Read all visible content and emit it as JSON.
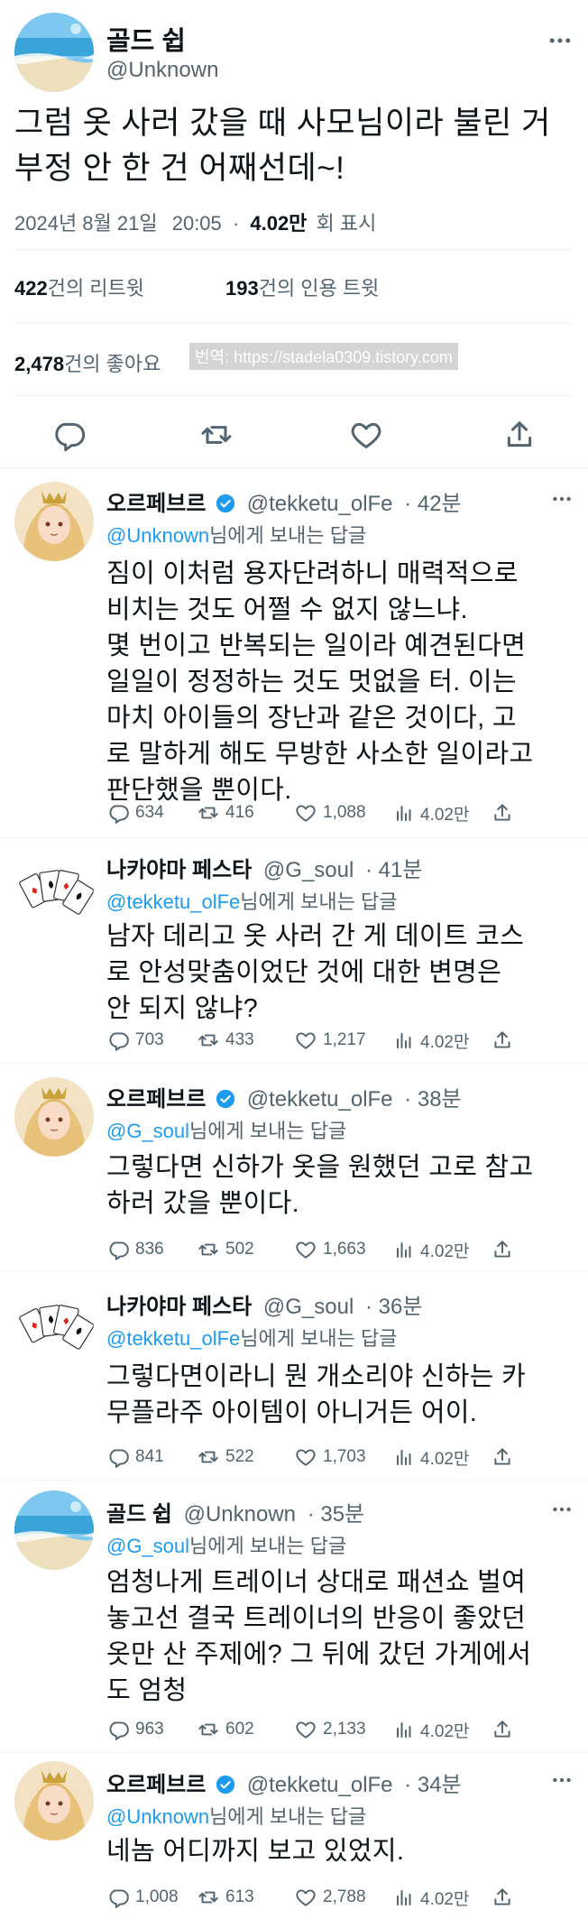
{
  "main_tweet": {
    "name": "골드 쉽",
    "handle": "@Unknown",
    "text": "그럼 옷 사러 갔을 때 사모님이라 불린 거\n부정 안 한 건 어째선데~!",
    "date": "2024년 8월 21일",
    "time": "20:05",
    "dot": "·",
    "views": "4.02만",
    "views_label": "회 표시",
    "retweets": "422",
    "retweets_label": "건의 리트윗",
    "quotes": "193",
    "quotes_label": "건의 인용 트윗",
    "likes": "2,478",
    "likes_label": "건의 좋아요",
    "watermark": "번역: https://stadela0309.tistory.com"
  },
  "replies": [
    {
      "name": "오르페브르",
      "handle": "@tekketu_olFe",
      "time": "· 42분",
      "to_mention": "@Unknown",
      "to_suffix": "님에게 보내는 답글",
      "text": "짐이 이처럼 용자단려하니 매력적으로\n비치는 것도 어쩔 수 없지 않느냐.\n몇 번이고 반복되는 일이라 예견된다면\n일일이 정정하는 것도 멋없을 터. 이는\n마치 아이들의 장난과 같은 것이다, 고\n로 말하게 해도 무방한 사소한 일이라고\n판단했을 뿐이다.",
      "replies": "634",
      "retweets": "416",
      "likes": "1,088",
      "views": "4.02만"
    },
    {
      "name": "나카야마 페스타",
      "handle": "@G_soul",
      "time": "· 41분",
      "to_mention": "@tekketu_olFe",
      "to_suffix": "님에게 보내는 답글",
      "text": "남자 데리고 옷 사러 간 게 데이트 코스\n로 안성맞춤이었단 것에 대한 변명은\n안 되지 않냐?",
      "replies": "703",
      "retweets": "433",
      "likes": "1,217",
      "views": "4.02만"
    },
    {
      "name": "오르페브르",
      "handle": "@tekketu_olFe",
      "time": "· 38분",
      "to_mention": "@G_soul",
      "to_suffix": "님에게 보내는 답글",
      "text": "그렇다면 신하가 옷을 원했던 고로 참고\n하러 갔을 뿐이다.",
      "replies": "836",
      "retweets": "502",
      "likes": "1,663",
      "views": "4.02만"
    },
    {
      "name": "나카야마 페스타",
      "handle": "@G_soul",
      "time": "· 36분",
      "to_mention": "@tekketu_olFe",
      "to_suffix": "님에게 보내는 답글",
      "text": "그렇다면이라니 뭔 개소리야 신하는 카\n무플라주 아이템이 아니거든 어이.",
      "replies": "841",
      "retweets": "522",
      "likes": "1,703",
      "views": "4.02만"
    },
    {
      "name": "골드 쉽",
      "handle": "@Unknown",
      "time": "· 35분",
      "to_mention": "@G_soul",
      "to_suffix": "님에게 보내는 답글",
      "text": "엄청나게 트레이너 상대로 패션쇼 벌여\n놓고선 결국 트레이너의 반응이 좋았던\n옷만 산 주제에? 그 뒤에 갔던 가게에서\n도 엄청",
      "replies": "963",
      "retweets": "602",
      "likes": "2,133",
      "views": "4.02만"
    },
    {
      "name": "오르페브르",
      "handle": "@tekketu_olFe",
      "time": "· 34분",
      "to_mention": "@Unknown",
      "to_suffix": "님에게 보내는 답글",
      "text": "네놈 어디까지 보고 있었지.",
      "replies": "1,008",
      "retweets": "613",
      "likes": "2,788",
      "views": "4.02만"
    }
  ],
  "colors": {
    "text": "#0f1419",
    "secondary": "#536471",
    "mention": "#1d9bf0",
    "divider": "#eff3f4"
  }
}
